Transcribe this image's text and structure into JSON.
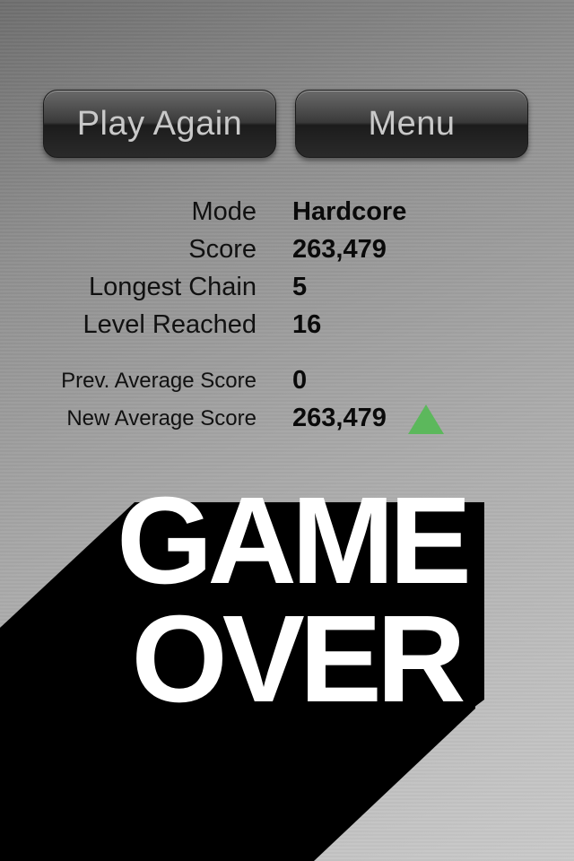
{
  "buttons": {
    "play_again": "Play Again",
    "menu": "Menu"
  },
  "stats": {
    "mode": {
      "label": "Mode",
      "value": "Hardcore"
    },
    "score": {
      "label": "Score",
      "value": "263,479"
    },
    "longest_chain": {
      "label": "Longest Chain",
      "value": "5"
    },
    "level_reached": {
      "label": "Level Reached",
      "value": "16"
    },
    "prev_average": {
      "label": "Prev. Average Score",
      "value": "0"
    },
    "new_average": {
      "label": "New Average Score",
      "value": "263,479",
      "trend_icon": "up-triangle-icon",
      "trend_color": "#5cb85c"
    }
  },
  "title": {
    "line1": "GAME",
    "line2": "OVER"
  }
}
